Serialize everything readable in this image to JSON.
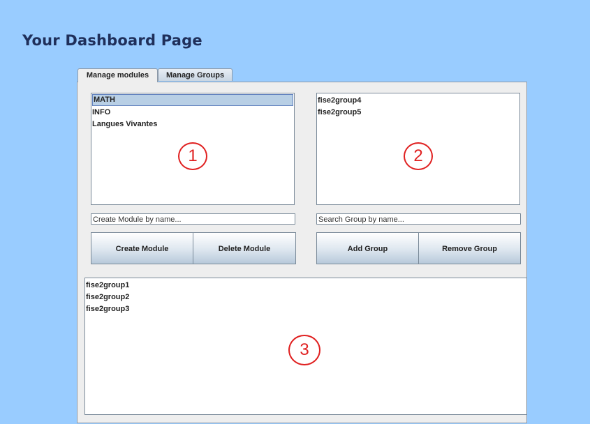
{
  "page": {
    "title": "Your Dashboard Page"
  },
  "tabs": [
    {
      "label": "Manage modules",
      "active": true
    },
    {
      "label": "Manage Groups",
      "active": false
    }
  ],
  "modules_list": {
    "items": [
      "MATH",
      "INFO",
      "Langues Vivantes"
    ],
    "selected": "MATH",
    "marker": "1"
  },
  "module_groups_list": {
    "items": [
      "fise2group4",
      "fise2group5"
    ],
    "marker": "2"
  },
  "module_input": {
    "value": "Create Module by name..."
  },
  "group_search": {
    "value": "Search Group by name..."
  },
  "buttons": {
    "create_module": "Create Module",
    "delete_module": "Delete Module",
    "add_group": "Add Group",
    "remove_group": "Remove Group"
  },
  "all_groups_list": {
    "items": [
      "fise2group1",
      "fise2group2",
      "fise2group3"
    ],
    "marker": "3"
  },
  "colors": {
    "background": "#99ccff",
    "marker": "#e02020",
    "title": "#1f2f5a"
  }
}
